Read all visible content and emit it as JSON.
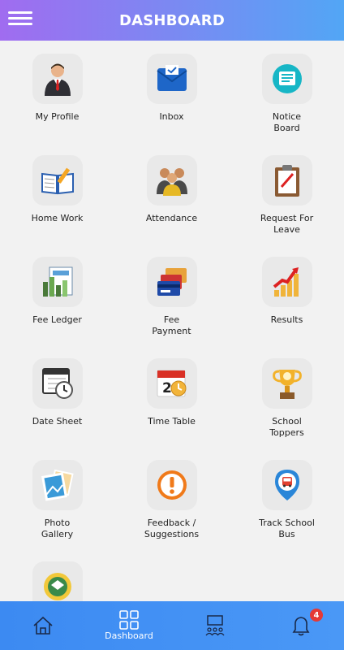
{
  "header": {
    "title": "DASHBOARD",
    "menu_icon": "hamburger-menu-icon"
  },
  "tiles": [
    {
      "label": "My Profile",
      "icon": "user-profile-icon"
    },
    {
      "label": "Inbox",
      "icon": "mail-icon"
    },
    {
      "label": "Notice\nBoard",
      "icon": "notice-board-icon"
    },
    {
      "label": "Home Work",
      "icon": "book-pencil-icon"
    },
    {
      "label": "Attendance",
      "icon": "group-people-icon"
    },
    {
      "label": "Request For\nLeave",
      "icon": "clipboard-icon"
    },
    {
      "label": "Fee Ledger",
      "icon": "ledger-chart-icon"
    },
    {
      "label": "Fee\nPayment",
      "icon": "credit-cards-icon"
    },
    {
      "label": "Results",
      "icon": "rising-bar-chart-icon"
    },
    {
      "label": "Date Sheet",
      "icon": "calendar-clock-icon"
    },
    {
      "label": "Time Table",
      "icon": "calendar-day-icon"
    },
    {
      "label": "School\nToppers",
      "icon": "trophy-icon"
    },
    {
      "label": "Photo\nGallery",
      "icon": "photos-icon"
    },
    {
      "label": "Feedback /\nSuggestions",
      "icon": "warning-circle-icon"
    },
    {
      "label": "Track School\nBus",
      "icon": "bus-location-icon"
    },
    {
      "label": "",
      "icon": "school-emblem-icon"
    }
  ],
  "bottom_nav": {
    "items": [
      {
        "label": "",
        "icon": "home-icon"
      },
      {
        "label": "Dashboard",
        "icon": "dashboard-grid-icon"
      },
      {
        "label": "",
        "icon": "classroom-icon"
      },
      {
        "label": "",
        "icon": "bell-icon"
      }
    ],
    "notification_count": "4"
  },
  "colors": {
    "nav_bg": "#4a98f6",
    "header_start": "#a06cf0",
    "header_end": "#52a6f5",
    "badge": "#e53935"
  }
}
